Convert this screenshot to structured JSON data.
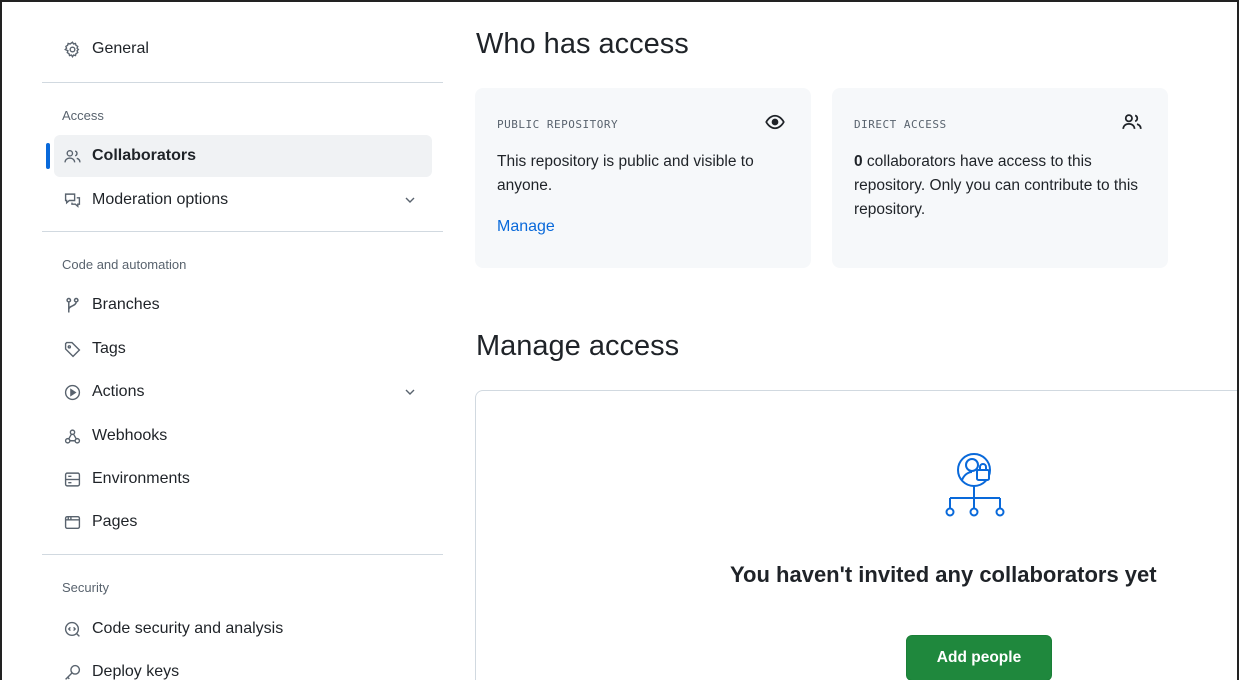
{
  "sidebar": {
    "general": "General",
    "sections": {
      "access": "Access",
      "code_automation": "Code and automation",
      "security": "Security"
    },
    "items": {
      "collaborators": "Collaborators",
      "moderation": "Moderation options",
      "branches": "Branches",
      "tags": "Tags",
      "actions": "Actions",
      "webhooks": "Webhooks",
      "environments": "Environments",
      "pages": "Pages",
      "code_security": "Code security and analysis",
      "deploy_keys": "Deploy keys"
    },
    "active_item": "Collaborators"
  },
  "who_has_access": {
    "title": "Who has access",
    "public_card": {
      "label": "PUBLIC REPOSITORY",
      "body": "This repository is public and visible to anyone.",
      "link": "Manage",
      "icon": "eye-icon"
    },
    "direct_card": {
      "label": "DIRECT ACCESS",
      "count": "0",
      "body_rest": " collaborators have access to this repository. Only you can contribute to this repository.",
      "icon": "people-icon"
    }
  },
  "manage_access": {
    "title": "Manage access",
    "empty_title": "You haven't invited any collaborators yet",
    "add_button": "Add people",
    "icon": "collaborators-lock-icon"
  },
  "colors": {
    "accent": "#0969da",
    "primary_button": "#1f883d",
    "active_bar": "#0969da",
    "card_bg": "#f6f8fa"
  }
}
